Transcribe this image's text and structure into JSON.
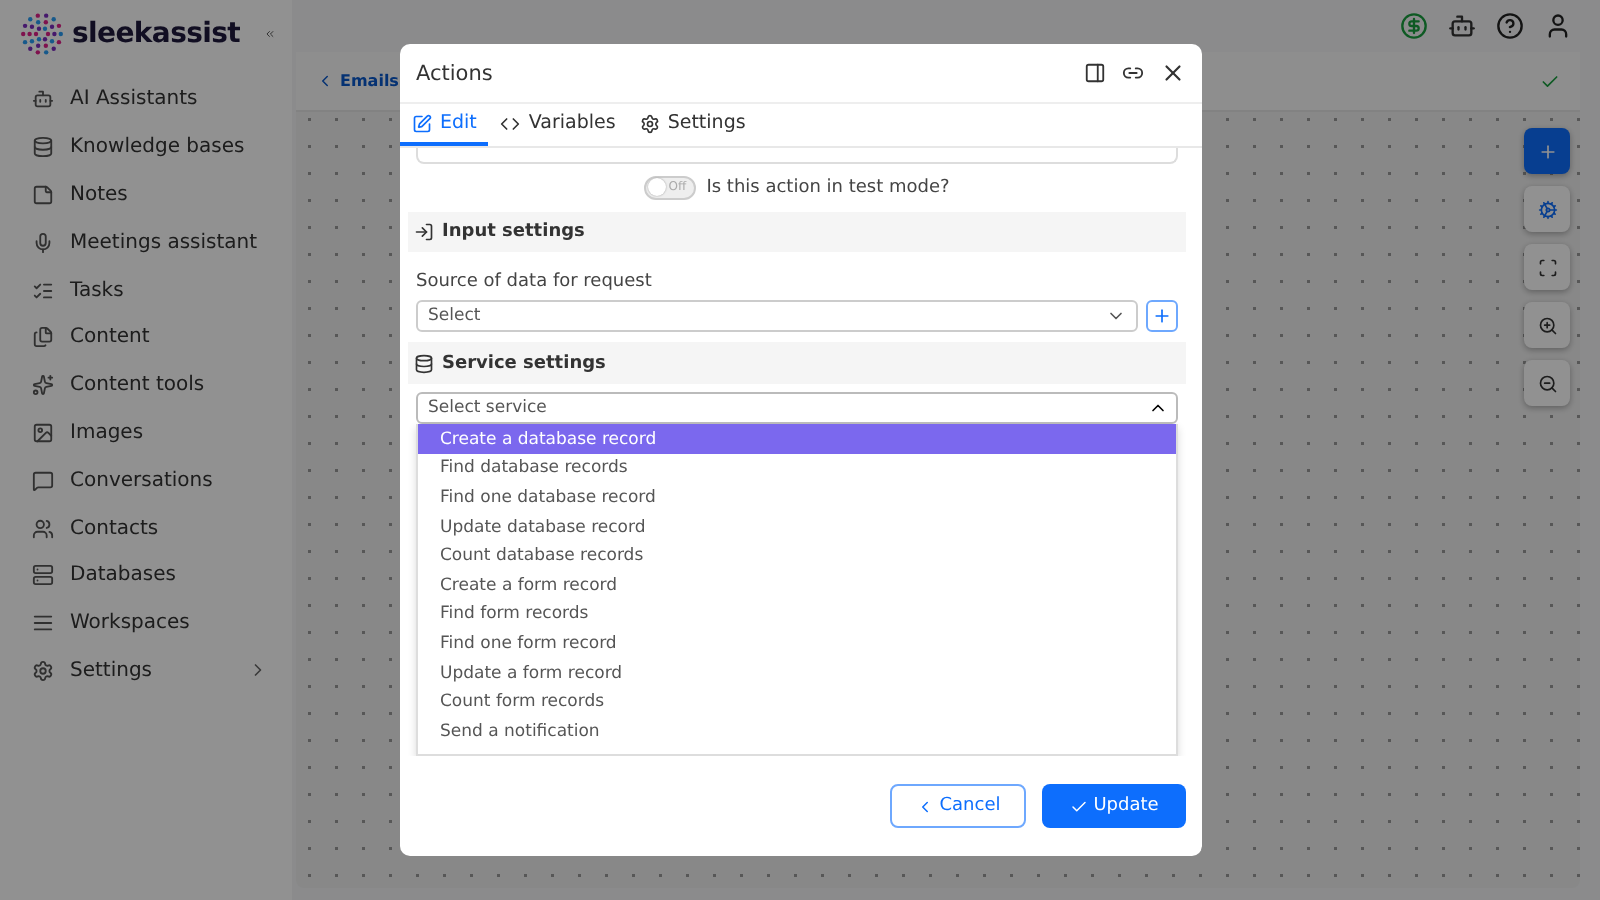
{
  "brand": "sleekassist",
  "sidebar": {
    "items": [
      {
        "label": "AI Assistants",
        "has_children": false
      },
      {
        "label": "Knowledge bases",
        "has_children": false
      },
      {
        "label": "Notes",
        "has_children": false
      },
      {
        "label": "Meetings assistant",
        "has_children": false
      },
      {
        "label": "Tasks",
        "has_children": false
      },
      {
        "label": "Content",
        "has_children": false
      },
      {
        "label": "Content tools",
        "has_children": false
      },
      {
        "label": "Images",
        "has_children": false
      },
      {
        "label": "Conversations",
        "has_children": false
      },
      {
        "label": "Contacts",
        "has_children": false
      },
      {
        "label": "Databases",
        "has_children": false
      },
      {
        "label": "Workspaces",
        "has_children": false
      },
      {
        "label": "Settings",
        "has_children": true
      }
    ]
  },
  "canvas": {
    "back_link": "Emails"
  },
  "dialog": {
    "title": "Actions",
    "tabs": [
      {
        "label": "Edit",
        "selected": true
      },
      {
        "label": "Variables",
        "selected": false
      },
      {
        "label": "Settings",
        "selected": false
      }
    ],
    "test_mode": {
      "toggle_text": "Off",
      "on": false,
      "label": "Is this action in test mode?"
    },
    "input_settings": {
      "title": "Input settings",
      "source_label": "Source of data for request",
      "source_value": "Select"
    },
    "service_settings": {
      "title": "Service settings",
      "placeholder": "Select service",
      "options": [
        {
          "label": "Create a database record",
          "selected": true
        },
        {
          "label": "Find database records",
          "selected": false
        },
        {
          "label": "Find one database record",
          "selected": false
        },
        {
          "label": "Update database record",
          "selected": false
        },
        {
          "label": "Count database records",
          "selected": false
        },
        {
          "label": "Create a form record",
          "selected": false
        },
        {
          "label": "Find form records",
          "selected": false
        },
        {
          "label": "Find one form record",
          "selected": false
        },
        {
          "label": "Update a form record",
          "selected": false
        },
        {
          "label": "Count form records",
          "selected": false
        },
        {
          "label": "Send a notification",
          "selected": false
        }
      ]
    },
    "buttons": {
      "cancel": "Cancel",
      "update": "Update"
    }
  }
}
